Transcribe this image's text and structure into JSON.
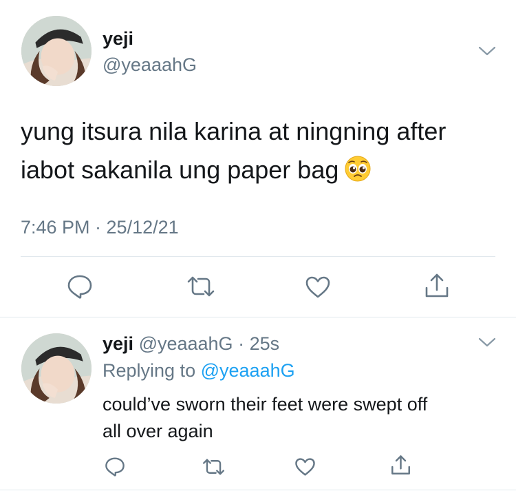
{
  "main_tweet": {
    "display_name": "yeji",
    "handle": "@yeaaahG",
    "text_line1": "yung itsura nila karina at ningning after",
    "text_line2": "iabot sakanila ung paper bag",
    "emoji": "pleading-face",
    "timestamp": "7:46 PM · 25/12/21",
    "actions": [
      "reply-icon",
      "retweet-icon",
      "like-icon",
      "share-icon"
    ]
  },
  "reply_tweet": {
    "display_name": "yeji",
    "handle": "@yeaaahG",
    "separator": "·",
    "time_ago": "25s",
    "replying_prefix": "Replying to",
    "replying_to": "@yeaaahG",
    "text_line1": "could’ve sworn their feet were swept off",
    "text_line2": "all over again",
    "actions": [
      "reply-icon",
      "retweet-icon",
      "like-icon",
      "share-icon"
    ]
  },
  "colors": {
    "text": "#14171a",
    "muted": "#657786",
    "link": "#1da1f2",
    "divider": "#e1e8ed"
  }
}
